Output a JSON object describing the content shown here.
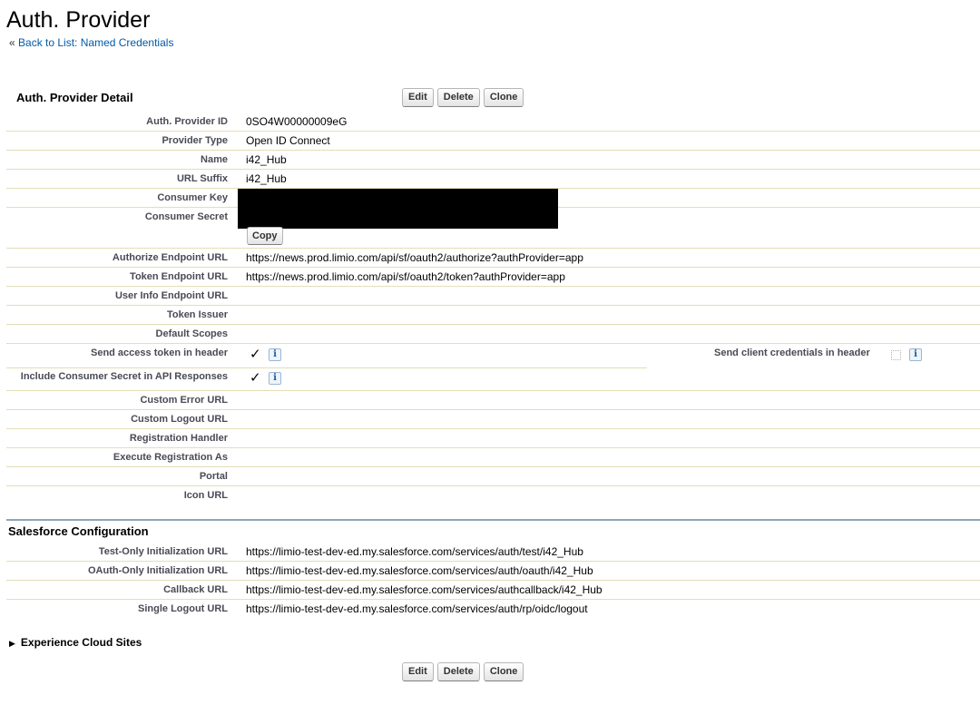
{
  "page": {
    "title": "Auth. Provider",
    "back_prefix": "«",
    "back_link": "Back to List: Named Credentials"
  },
  "buttons": {
    "edit": "Edit",
    "delete": "Delete",
    "clone": "Clone",
    "copy": "Copy"
  },
  "detail": {
    "title": "Auth. Provider Detail",
    "rows": [
      {
        "label": "Auth. Provider ID",
        "value": "0SO4W00000009eG"
      },
      {
        "label": "Provider Type",
        "value": "Open ID Connect"
      },
      {
        "label": "Name",
        "value": "i42_Hub"
      },
      {
        "label": "URL Suffix",
        "value": "i42_Hub"
      },
      {
        "label": "Consumer Key",
        "value": ""
      },
      {
        "label": "Consumer Secret",
        "value": ""
      },
      {
        "label": "Authorize Endpoint URL",
        "value": "https://news.prod.limio.com/api/sf/oauth2/authorize?authProvider=app"
      },
      {
        "label": "Token Endpoint URL",
        "value": "https://news.prod.limio.com/api/sf/oauth2/token?authProvider=app"
      },
      {
        "label": "User Info Endpoint URL",
        "value": ""
      },
      {
        "label": "Token Issuer",
        "value": ""
      },
      {
        "label": "Default Scopes",
        "value": ""
      },
      {
        "label": "Send access token in header",
        "value": ""
      },
      {
        "label": "Include Consumer Secret in API Responses",
        "value": ""
      },
      {
        "label": "Custom Error URL",
        "value": ""
      },
      {
        "label": "Custom Logout URL",
        "value": ""
      },
      {
        "label": "Registration Handler",
        "value": ""
      },
      {
        "label": "Execute Registration As",
        "value": ""
      },
      {
        "label": "Portal",
        "value": ""
      },
      {
        "label": "Icon URL",
        "value": ""
      }
    ],
    "send_client_credentials_label": "Send client credentials in header",
    "checkmark": "✓",
    "info_glyph": "i"
  },
  "salesforce_config": {
    "title": "Salesforce Configuration",
    "rows": [
      {
        "label": "Test-Only Initialization URL",
        "value": "https://limio-test-dev-ed.my.salesforce.com/services/auth/test/i42_Hub"
      },
      {
        "label": "OAuth-Only Initialization URL",
        "value": "https://limio-test-dev-ed.my.salesforce.com/services/auth/oauth/i42_Hub"
      },
      {
        "label": "Callback URL",
        "value": "https://limio-test-dev-ed.my.salesforce.com/services/authcallback/i42_Hub"
      },
      {
        "label": "Single Logout URL",
        "value": "https://limio-test-dev-ed.my.salesforce.com/services/auth/rp/oidc/logout"
      }
    ]
  },
  "experience_cloud": {
    "label": "Experience Cloud Sites",
    "arrow": "▶"
  },
  "icons": {
    "info": "info-icon",
    "check": "checkmark-icon",
    "toggle": "triangle-right-icon"
  }
}
